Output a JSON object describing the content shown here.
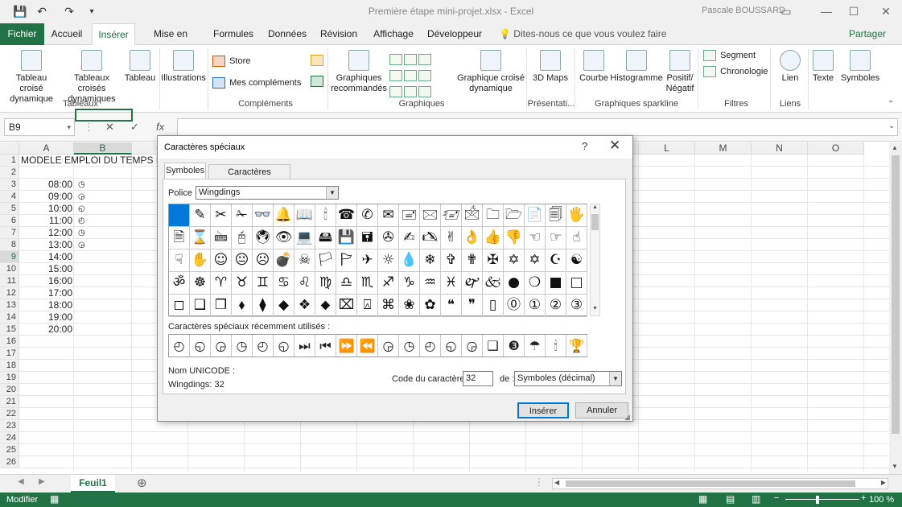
{
  "window": {
    "title": "Première étape mini-projet.xlsx  -  Excel",
    "user": "Pascale BOUSSARD"
  },
  "tabs": [
    "Fichier",
    "Accueil",
    "Insérer",
    "Mise en page",
    "Formules",
    "Données",
    "Révision",
    "Affichage",
    "Développeur"
  ],
  "tell_me": "Dites-nous ce que vous voulez faire",
  "share": "Partager",
  "ribbon": {
    "tableaux": {
      "pivot": "Tableau croisé dynamique",
      "rec_pivot": "Tableaux croisés dynamiques",
      "table": "Tableau",
      "group": "Tableaux"
    },
    "illustrations": "Illustrations",
    "complements": {
      "store": "Store",
      "mine": "Mes compléments",
      "group": "Compléments"
    },
    "graphiques": {
      "recommended": "Graphiques recommandés",
      "pivot_chart": "Graphique croisé dynamique",
      "group": "Graphiques"
    },
    "tours": {
      "maps": "3D Maps",
      "group": "Présentati..."
    },
    "sparklines": {
      "line": "Courbe",
      "histo": "Histogramme",
      "winloss": "Positif/ Négatif",
      "group": "Graphiques sparkline"
    },
    "filtres": {
      "slicer": "Segment",
      "timeline": "Chronologie",
      "group": "Filtres"
    },
    "liens": {
      "link": "Lien",
      "group": "Liens"
    },
    "texte": "Texte",
    "symboles": "Symboles"
  },
  "formula_bar": {
    "name_box": "B9",
    "cancel": "✕",
    "enter": "✓",
    "fx": "fx"
  },
  "columns": [
    "A",
    "B",
    "C",
    "D",
    "E",
    "F",
    "G",
    "H",
    "I",
    "J",
    "K",
    "L",
    "M",
    "N",
    "O"
  ],
  "rows": [
    "1",
    "2",
    "3",
    "4",
    "5",
    "6",
    "7",
    "8",
    "9",
    "10",
    "11",
    "12",
    "13",
    "14",
    "15",
    "16",
    "17",
    "18",
    "19",
    "20",
    "21",
    "22",
    "23",
    "24",
    "25",
    "26"
  ],
  "cells": {
    "a1": "MODELE EMPLOI DU TEMPS FA",
    "times": [
      "08:00",
      "09:00",
      "10:00",
      "11:00",
      "12:00",
      "13:00",
      "14:00",
      "15:00",
      "16:00",
      "17:00",
      "18:00",
      "19:00",
      "20:00"
    ],
    "clocks": [
      "◷",
      "◶",
      "◵",
      "◴",
      "◷",
      "◶"
    ]
  },
  "sheet_tab": "Feuil1",
  "status": {
    "mode": "Modifier",
    "zoom": "100 %"
  },
  "dialog": {
    "title": "Caractères spéciaux",
    "help": "?",
    "close": "✕",
    "tab_symbols": "Symboles",
    "tab_special": "Caractères spéciaux",
    "font_label": "Police :",
    "font_value": "Wingdings",
    "symbols": [
      [
        "",
        "✎",
        "✂",
        "✁",
        "👓",
        "🔔",
        "📖",
        "🕯",
        "☎",
        "✆",
        "✉",
        "🖃",
        "🖂",
        "🖅",
        "🖄",
        "🗀",
        "🗁",
        "📄",
        "🗐",
        "🖐"
      ],
      [
        "🗎",
        "⌛",
        "🖮",
        "🖰",
        "🖲",
        "👁",
        "💻",
        "🖴",
        "💾",
        "🖬",
        "✇",
        "✍",
        "🖎",
        "✌",
        "👌",
        "👍",
        "👎",
        "☜",
        "☞",
        "☝"
      ],
      [
        "☟",
        "✋",
        "☺",
        "😐",
        "☹",
        "💣",
        "☠",
        "🏳",
        "🏱",
        "✈",
        "☼",
        "💧",
        "❄",
        "✞",
        "✟",
        "✠",
        "✡",
        "✡",
        "☪",
        "☯"
      ],
      [
        "ॐ",
        "☸",
        "♈",
        "♉",
        "♊",
        "♋",
        "♌",
        "♍",
        "♎",
        "♏",
        "♐",
        "♑",
        "♒",
        "♓",
        "🙰",
        "🙵",
        "●",
        "❍",
        "■",
        "□"
      ],
      [
        "◻",
        "❑",
        "❒",
        "⬧",
        "⧫",
        "◆",
        "❖",
        "⬥",
        "⌧",
        "⍓",
        "⌘",
        "❀",
        "✿",
        "❝",
        "❞",
        "▯",
        "⓪",
        "①",
        "②",
        "③"
      ]
    ],
    "recent_label": "Caractères spéciaux récemment utilisés :",
    "recent": [
      "◴",
      "◵",
      "◶",
      "◷",
      "◴",
      "◵",
      "⏭",
      "⏮",
      "⏩",
      "⏪",
      "◶",
      "◷",
      "◴",
      "◵",
      "◶",
      "❑",
      "❸",
      "☂",
      "🕯",
      "🏆"
    ],
    "unicode_label": "Nom UNICODE :",
    "unicode_value": "Wingdings: 32",
    "code_label": "Code du caractère :",
    "code_value": "32",
    "from_label": "de :",
    "from_value": "Symboles (décimal)",
    "insert": "Insérer",
    "cancel": "Annuler"
  }
}
